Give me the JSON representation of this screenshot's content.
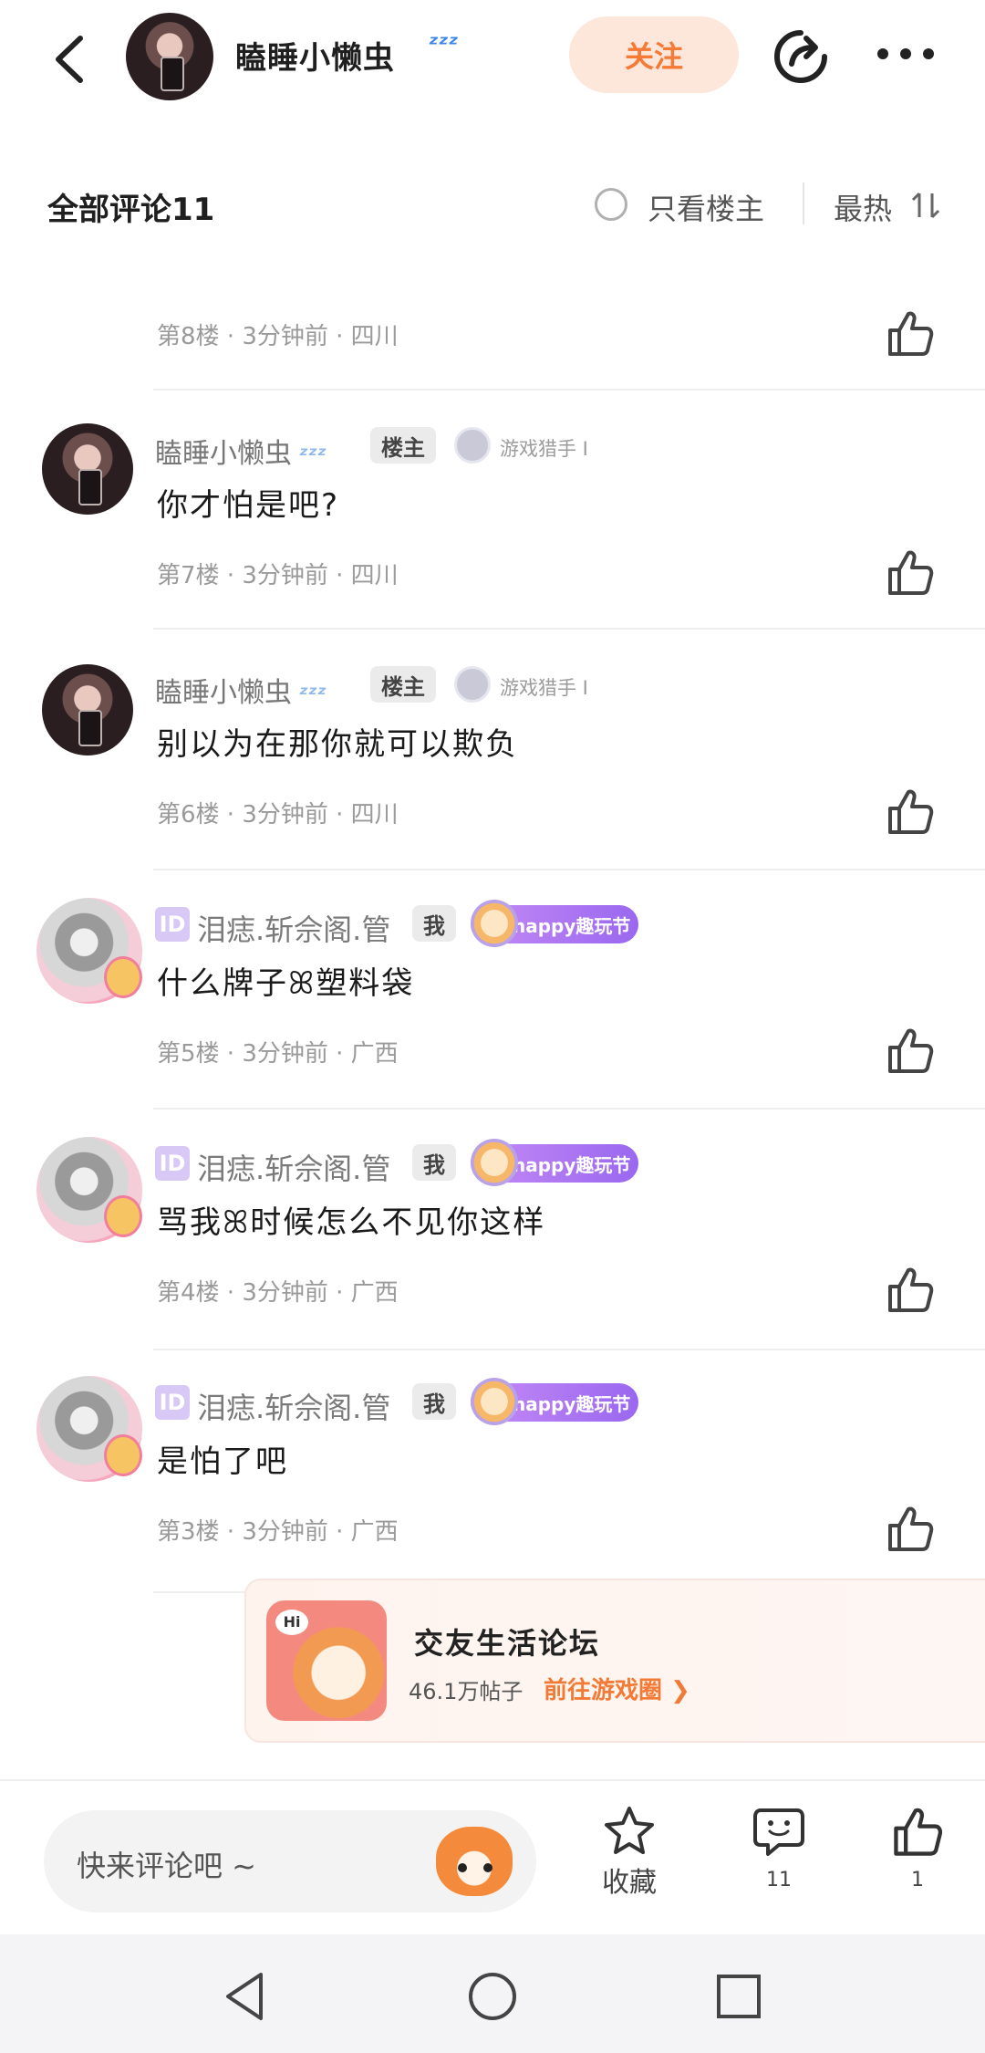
{
  "header": {
    "user_name": "瞌睡小懒虫",
    "status_emoji": "zzz",
    "follow_label": "关注",
    "icons": {
      "back": "back-arrow-icon",
      "share": "share-icon",
      "more": "more-dots-icon"
    }
  },
  "comments_header": {
    "title": "全部评论11",
    "only_host_label": "只看楼主",
    "sort_label": "最热"
  },
  "comments": [
    {
      "meta": "第8楼 · 3分钟前 · 四川"
    },
    {
      "user": "瞌睡小懒虫",
      "host_tag": "楼主",
      "badge": "游戏猎手 I",
      "text": "你才怕是吧?",
      "meta": "第7楼 · 3分钟前 · 四川"
    },
    {
      "user": "瞌睡小懒虫",
      "host_tag": "楼主",
      "badge": "游戏猎手 I",
      "text": "别以为在那你就可以欺负",
      "meta": "第6楼 · 3分钟前 · 四川"
    },
    {
      "id_badge": "ID",
      "user": "泪痣.斩佘阁.管",
      "me_tag": "我",
      "badge": "happy趣玩节",
      "text": "什么牌子ꕤ塑料袋",
      "meta": "第5楼 · 3分钟前 · 广西"
    },
    {
      "id_badge": "ID",
      "user": "泪痣.斩佘阁.管",
      "me_tag": "我",
      "badge": "happy趣玩节",
      "text": "骂我ꕤ时候怎么不见你这样",
      "meta": "第4楼 · 3分钟前 · 广西"
    },
    {
      "id_badge": "ID",
      "user": "泪痣.斩佘阁.管",
      "me_tag": "我",
      "badge": "happy趣玩节",
      "text": "是怕了吧",
      "meta": "第3楼 · 3分钟前 · 广西"
    }
  ],
  "forum_card": {
    "title": "交友生活论坛",
    "post_count": "46.1万帖子",
    "link_label": "前往游戏圈",
    "thumb_text": "Hi"
  },
  "bottom_bar": {
    "comment_placeholder": "快来评论吧 ~",
    "favorite_label": "收藏",
    "comment_count": "11",
    "like_count": "1"
  },
  "colors": {
    "accent": "#f47a36",
    "follow_bg": "#fde6da",
    "badge_purple": "#a974f2"
  }
}
